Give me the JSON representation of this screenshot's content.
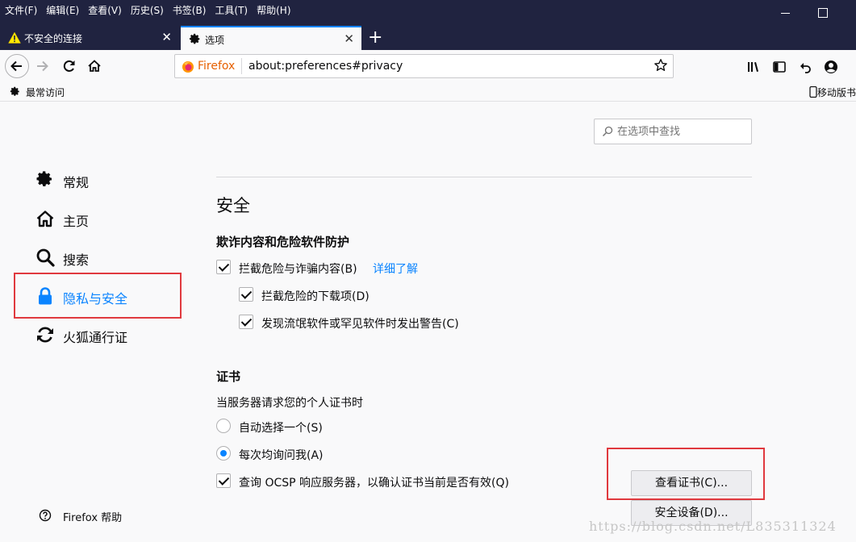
{
  "menu": [
    "文件(F)",
    "编辑(E)",
    "查看(V)",
    "历史(S)",
    "书签(B)",
    "工具(T)",
    "帮助(H)"
  ],
  "tabs": [
    {
      "label": "不安全的连接",
      "icon": "warning-icon"
    },
    {
      "label": "选项",
      "icon": "gear-icon"
    }
  ],
  "urlbar": {
    "brand": "Firefox",
    "url": "about:preferences#privacy"
  },
  "bookmarks": {
    "most_visited": "最常访问",
    "mobile": "移动版书"
  },
  "search": {
    "placeholder": "在选项中查找"
  },
  "categories": [
    {
      "label": "常规",
      "icon": "gear-icon"
    },
    {
      "label": "主页",
      "icon": "home-icon"
    },
    {
      "label": "搜索",
      "icon": "search-icon"
    },
    {
      "label": "隐私与安全",
      "icon": "lock-icon"
    },
    {
      "label": "火狐通行证",
      "icon": "sync-icon"
    }
  ],
  "help": "Firefox 帮助",
  "security": {
    "title": "安全",
    "fraud_heading": "欺诈内容和危险软件防护",
    "block_dangerous": "拦截危险与诈骗内容(B)",
    "learn_more": "详细了解",
    "block_downloads": "拦截危险的下载项(D)",
    "warn_unwanted": "发现流氓软件或罕见软件时发出警告(C)"
  },
  "certs": {
    "heading": "证书",
    "prompt": "当服务器请求您的个人证书时",
    "auto_select": "自动选择一个(S)",
    "ask_every": "每次均询问我(A)",
    "ocsp": "查询 OCSP 响应服务器，以确认证书当前是否有效(Q)",
    "view_button": "查看证书(C)...",
    "devices_button": "安全设备(D)..."
  },
  "watermark": "https://blog.csdn.net/L835311324",
  "colors": {
    "accent": "#0a84ff",
    "titlebar": "#202340",
    "highlight": "#e0393e"
  }
}
